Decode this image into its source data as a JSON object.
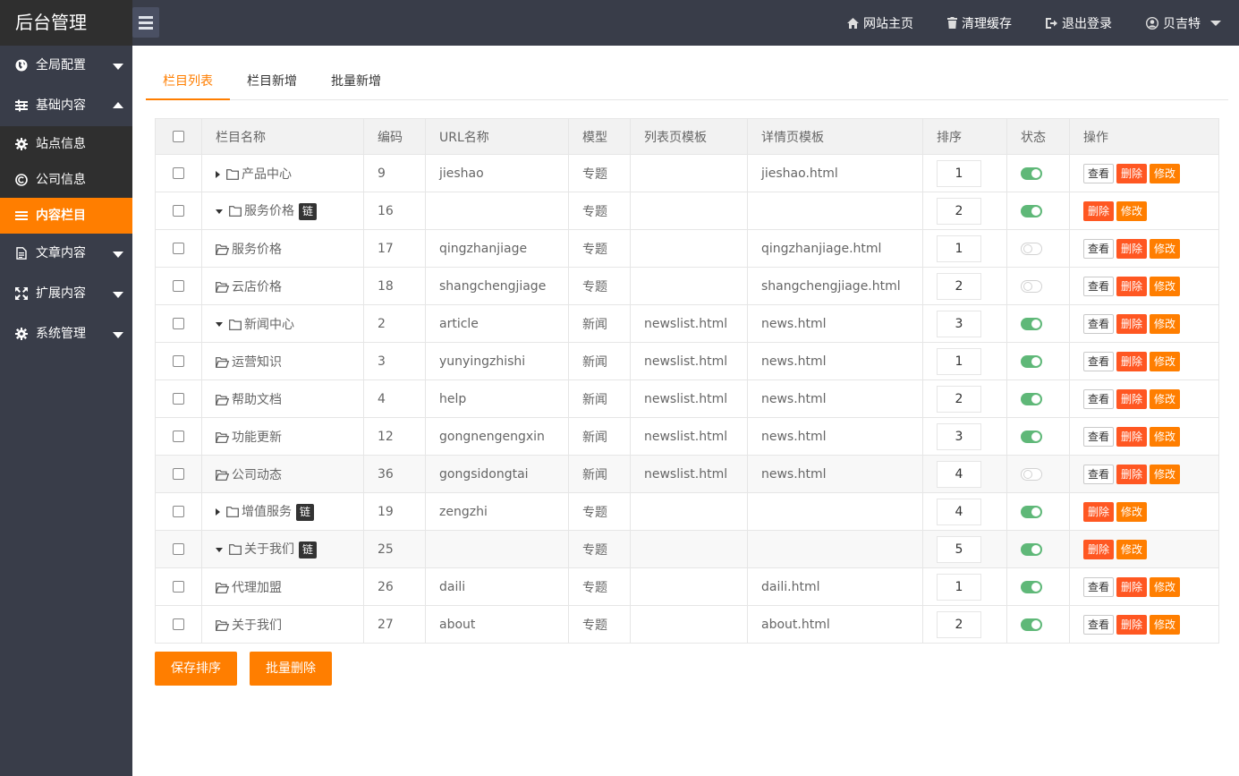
{
  "header": {
    "logo": "后台管理",
    "nav": {
      "home": "网站主页",
      "clear_cache": "清理缓存",
      "logout": "退出登录",
      "user": "贝吉特"
    }
  },
  "sidebar": {
    "items": [
      {
        "label": "全局配置"
      },
      {
        "label": "基础内容"
      },
      {
        "label": "站点信息"
      },
      {
        "label": "公司信息"
      },
      {
        "label": "内容栏目"
      },
      {
        "label": "文章内容"
      },
      {
        "label": "扩展内容"
      },
      {
        "label": "系统管理"
      }
    ]
  },
  "tabs": [
    "栏目列表",
    "栏目新增",
    "批量新增"
  ],
  "table": {
    "headers": [
      "栏目名称",
      "编码",
      "URL名称",
      "模型",
      "列表页模板",
      "详情页模板",
      "排序",
      "状态",
      "操作"
    ],
    "rows": [
      {
        "name": "产品中心",
        "code": "9",
        "url": "jieshao",
        "model": "专题",
        "list_tpl": "",
        "detail_tpl": "jieshao.html",
        "sort": "1",
        "status": "on",
        "level": 1,
        "expand": "collapsed",
        "link": "",
        "view": true
      },
      {
        "name": "服务价格",
        "code": "16",
        "url": "",
        "model": "专题",
        "list_tpl": "",
        "detail_tpl": "",
        "sort": "2",
        "status": "on",
        "level": 1,
        "expand": "expanded",
        "link": "链",
        "view": false
      },
      {
        "name": "服务价格",
        "code": "17",
        "url": "qingzhanjiage",
        "model": "专题",
        "list_tpl": "",
        "detail_tpl": "qingzhanjiage.html",
        "sort": "1",
        "status": "off",
        "level": 2,
        "expand": "",
        "link": "",
        "view": true
      },
      {
        "name": "云店价格",
        "code": "18",
        "url": "shangchengjiage",
        "model": "专题",
        "list_tpl": "",
        "detail_tpl": "shangchengjiage.html",
        "sort": "2",
        "status": "off",
        "level": 2,
        "expand": "",
        "link": "",
        "view": true
      },
      {
        "name": "新闻中心",
        "code": "2",
        "url": "article",
        "model": "新闻",
        "list_tpl": "newslist.html",
        "detail_tpl": "news.html",
        "sort": "3",
        "status": "on",
        "level": 1,
        "expand": "expanded",
        "link": "",
        "view": true
      },
      {
        "name": "运营知识",
        "code": "3",
        "url": "yunyingzhishi",
        "model": "新闻",
        "list_tpl": "newslist.html",
        "detail_tpl": "news.html",
        "sort": "1",
        "status": "on",
        "level": 2,
        "expand": "",
        "link": "",
        "view": true
      },
      {
        "name": "帮助文档",
        "code": "4",
        "url": "help",
        "model": "新闻",
        "list_tpl": "newslist.html",
        "detail_tpl": "news.html",
        "sort": "2",
        "status": "on",
        "level": 2,
        "expand": "",
        "link": "",
        "view": true
      },
      {
        "name": "功能更新",
        "code": "12",
        "url": "gongnengengxin",
        "model": "新闻",
        "list_tpl": "newslist.html",
        "detail_tpl": "news.html",
        "sort": "3",
        "status": "on",
        "level": 2,
        "expand": "",
        "link": "",
        "view": true
      },
      {
        "name": "公司动态",
        "code": "36",
        "url": "gongsidongtai",
        "model": "新闻",
        "list_tpl": "newslist.html",
        "detail_tpl": "news.html",
        "sort": "4",
        "status": "off",
        "level": 2,
        "expand": "",
        "link": "",
        "view": true
      },
      {
        "name": "增值服务",
        "code": "19",
        "url": "zengzhi",
        "model": "专题",
        "list_tpl": "",
        "detail_tpl": "",
        "sort": "4",
        "status": "on",
        "level": 1,
        "expand": "collapsed",
        "link": "链",
        "view": false
      },
      {
        "name": "关于我们",
        "code": "25",
        "url": "",
        "model": "专题",
        "list_tpl": "",
        "detail_tpl": "",
        "sort": "5",
        "status": "on",
        "level": 1,
        "expand": "expanded",
        "link": "链",
        "view": false
      },
      {
        "name": "代理加盟",
        "code": "26",
        "url": "daili",
        "model": "专题",
        "list_tpl": "",
        "detail_tpl": "daili.html",
        "sort": "1",
        "status": "on",
        "level": 2,
        "expand": "",
        "link": "",
        "view": true
      },
      {
        "name": "关于我们",
        "code": "27",
        "url": "about",
        "model": "专题",
        "list_tpl": "",
        "detail_tpl": "about.html",
        "sort": "2",
        "status": "on",
        "level": 2,
        "expand": "",
        "link": "",
        "view": true
      }
    ],
    "btn_view": "查看",
    "btn_delete": "删除",
    "btn_edit": "修改"
  },
  "actions": {
    "save_sort": "保存排序",
    "batch_delete": "批量删除"
  },
  "colors": {
    "accent": "#FF7E00",
    "danger": "#FF5722",
    "switch_on": "#5FB878",
    "sidebar_bg": "#393D49"
  }
}
